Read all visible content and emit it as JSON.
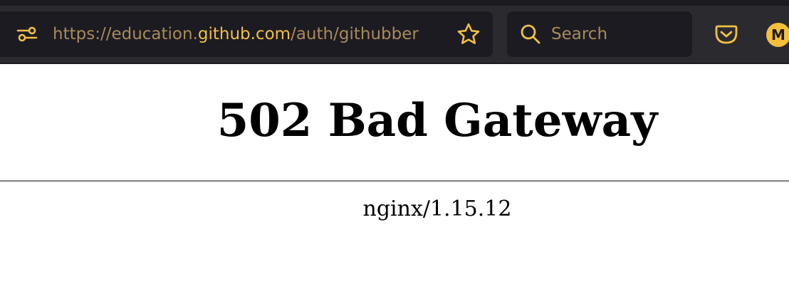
{
  "browser": {
    "url": {
      "prefix": "https://education.",
      "host": "github.com",
      "path": "/auth/githubber"
    },
    "search": {
      "placeholder": "Search"
    },
    "account": {
      "initial": "M"
    },
    "colors": {
      "accent": "#f0c044",
      "muted_text": "#a98a5a",
      "toolbar_bg": "#2b2a2f",
      "field_bg": "#1c1b22"
    },
    "icons": {
      "site_info": "site-permissions-icon",
      "bookmark": "star-icon",
      "search": "search-icon",
      "pocket": "pocket-icon",
      "account": "account-avatar-icon"
    }
  },
  "page": {
    "title": "502 Bad Gateway",
    "server_signature": "nginx/1.15.12"
  }
}
